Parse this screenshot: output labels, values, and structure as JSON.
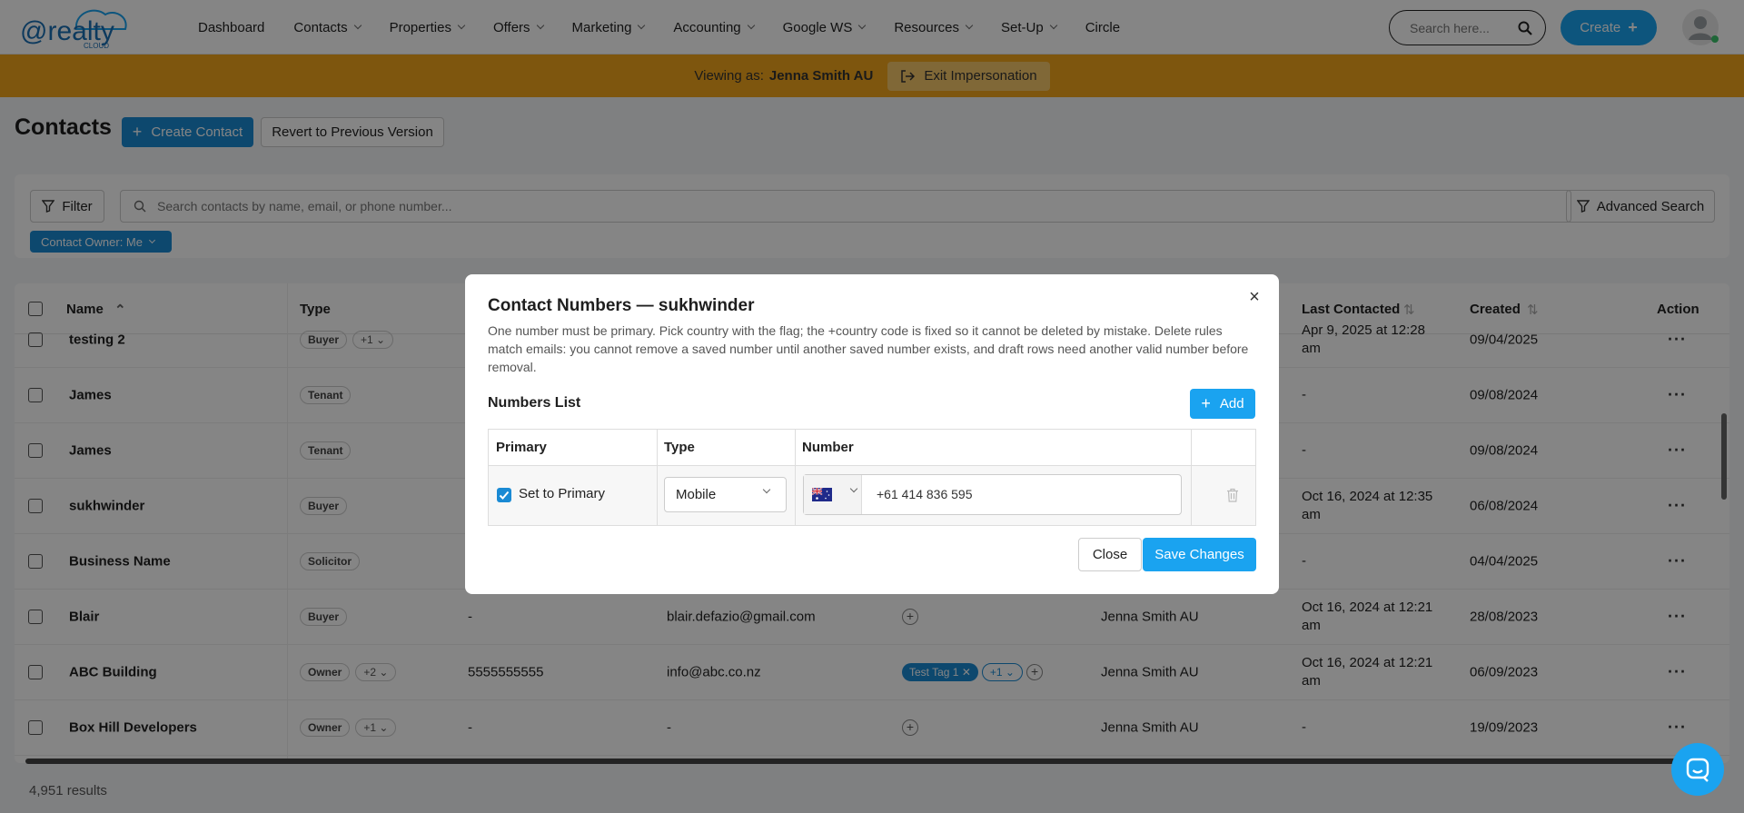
{
  "logo": {
    "text": "@realty",
    "sub": "CLOUD"
  },
  "nav": [
    {
      "label": "Dashboard",
      "dropdown": false
    },
    {
      "label": "Contacts",
      "dropdown": true
    },
    {
      "label": "Properties",
      "dropdown": true
    },
    {
      "label": "Offers",
      "dropdown": true
    },
    {
      "label": "Marketing",
      "dropdown": true
    },
    {
      "label": "Accounting",
      "dropdown": true
    },
    {
      "label": "Google WS",
      "dropdown": true
    },
    {
      "label": "Resources",
      "dropdown": true
    },
    {
      "label": "Set-Up",
      "dropdown": true
    },
    {
      "label": "Circle",
      "dropdown": false
    }
  ],
  "search": {
    "placeholder": "Search here..."
  },
  "create_label": "Create",
  "impersonation": {
    "prefix": "Viewing as:",
    "user": "Jenna Smith AU",
    "exit_label": "Exit Impersonation"
  },
  "page": {
    "title": "Contacts",
    "create_contact": "Create Contact",
    "revert": "Revert to Previous Version"
  },
  "filters": {
    "filter_label": "Filter",
    "search_placeholder": "Search contacts by name, email, or phone number...",
    "advanced_label": "Advanced Search",
    "owner_chip": "Contact Owner: Me"
  },
  "table": {
    "headers": {
      "name": "Name",
      "type": "Type",
      "last_contacted": "Last Contacted",
      "created": "Created",
      "action": "Action"
    },
    "rows": [
      {
        "name": "testing 2",
        "type": "Buyer",
        "type_more": "+1",
        "phone": "",
        "email": "",
        "tag": "",
        "tag_more": "",
        "owner": "",
        "last": "Apr 9, 2025 at 12:28 am",
        "created": "09/04/2025"
      },
      {
        "name": "James",
        "type": "Tenant",
        "type_more": "",
        "phone": "",
        "email": "",
        "tag": "",
        "tag_more": "",
        "owner": "",
        "last": "-",
        "created": "09/08/2024"
      },
      {
        "name": "James",
        "type": "Tenant",
        "type_more": "",
        "phone": "",
        "email": "",
        "tag": "",
        "tag_more": "",
        "owner": "",
        "last": "-",
        "created": "09/08/2024"
      },
      {
        "name": "sukhwinder",
        "type": "Buyer",
        "type_more": "",
        "phone": "",
        "email": "",
        "tag": "",
        "tag_more": "",
        "owner": "",
        "last": "Oct 16, 2024 at 12:35 am",
        "created": "06/08/2024"
      },
      {
        "name": "Business Name",
        "type": "Solicitor",
        "type_more": "",
        "phone": "",
        "email": "",
        "tag": "",
        "tag_more": "",
        "owner": "",
        "last": "-",
        "created": "04/04/2025"
      },
      {
        "name": "Blair",
        "type": "Buyer",
        "type_more": "",
        "phone": "-",
        "email": "blair.defazio@gmail.com",
        "tag": "",
        "tag_more": "",
        "owner": "Jenna Smith AU",
        "last": "Oct 16, 2024 at 12:21 am",
        "created": "28/08/2023"
      },
      {
        "name": "ABC Building",
        "type": "Owner",
        "type_more": "+2",
        "phone": "5555555555",
        "email": "info@abc.co.nz",
        "tag": "Test Tag 1",
        "tag_more": "+1",
        "owner": "Jenna Smith AU",
        "last": "Oct 16, 2024 at 12:21 am",
        "created": "06/09/2023"
      },
      {
        "name": "Box Hill Developers",
        "type": "Owner",
        "type_more": "+1",
        "phone": "-",
        "email": "-",
        "tag": "",
        "tag_more": "",
        "owner": "Jenna Smith AU",
        "last": "-",
        "created": "19/09/2023"
      }
    ],
    "results": "4,951 results"
  },
  "modal": {
    "title": "Contact Numbers — sukhwinder",
    "description": "One number must be primary. Pick country with the flag; the +country code is fixed so it cannot be deleted by mistake. Delete rules match emails: you cannot remove a saved number until another saved number exists, and draft rows need another valid number before removal.",
    "list_title": "Numbers List",
    "add_label": "Add",
    "headers": {
      "primary": "Primary",
      "type": "Type",
      "number": "Number"
    },
    "row": {
      "primary_label": "Set to Primary",
      "primary_checked": true,
      "type": "Mobile",
      "flag": "AU",
      "number": "+61 414 836 595"
    },
    "close_label": "Close",
    "save_label": "Save Changes"
  },
  "colors": {
    "accent": "#1aa3f0",
    "impersonation_bar": "#f2a51c",
    "chip": "#1a8ad4"
  }
}
